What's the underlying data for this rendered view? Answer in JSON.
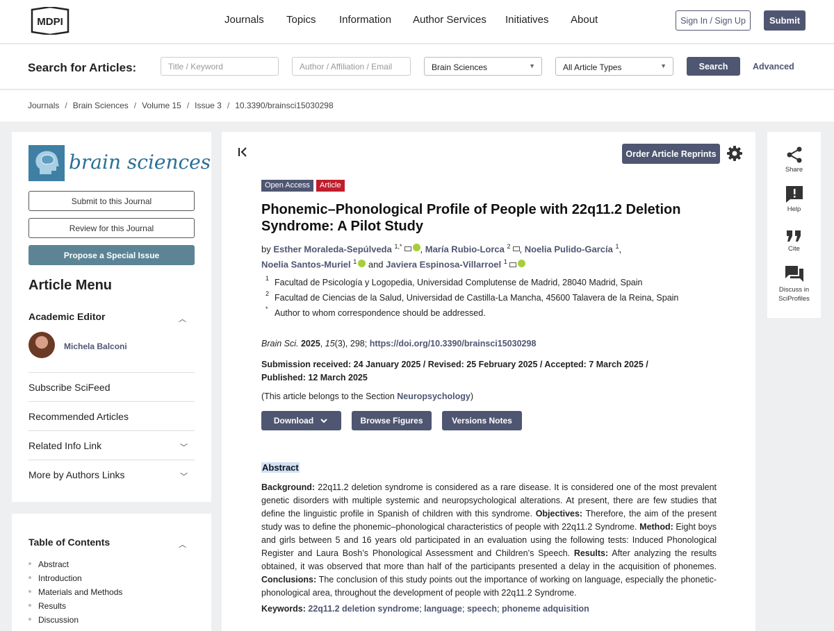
{
  "header": {
    "logo_text": "MDPI",
    "nav": [
      "Journals",
      "Topics",
      "Information",
      "Author Services",
      "Initiatives",
      "About"
    ],
    "sign_in_label": "Sign In / Sign Up",
    "submit_label": "Submit"
  },
  "search": {
    "title": "Search for Articles:",
    "keyword_placeholder": "Title / Keyword",
    "author_placeholder": "Author / Affiliation / Email",
    "journal_selected": "Brain Sciences",
    "type_selected": "All Article Types",
    "search_label": "Search",
    "advanced_label": "Advanced"
  },
  "breadcrumb": [
    "Journals",
    "Brain Sciences",
    "Volume 15",
    "Issue 3",
    "10.3390/brainsci15030298"
  ],
  "sidebar": {
    "journal_name": "brain sciences",
    "submit_label": "Submit to this Journal",
    "review_label": "Review for this Journal",
    "propose_label": "Propose a Special Issue",
    "menu_title": "Article Menu",
    "academic_editor_label": "Academic Editor",
    "editor_name": "Michela Balconi",
    "menu_items": [
      "Subscribe SciFeed",
      "Recommended Articles",
      "Related Info Link",
      "More by Authors Links"
    ],
    "toc_title": "Table of Contents",
    "toc_items": [
      "Abstract",
      "Introduction",
      "Materials and Methods",
      "Results",
      "Discussion"
    ]
  },
  "article": {
    "reprints_label": "Order Article Reprints",
    "badge_open_access": "Open Access",
    "badge_type": "Article",
    "title": "Phonemic–Phonological Profile of People with 22q11.2 Deletion Syndrome: A Pilot Study",
    "by": "by",
    "and": "and",
    "authors": [
      {
        "name": "Esther Moraleda-Sepúlveda",
        "sup": "1,*"
      },
      {
        "name": "María Rubio-Lorca",
        "sup": "2"
      },
      {
        "name": "Noelia Pulido-García",
        "sup": "1"
      },
      {
        "name": "Noelia Santos-Muriel",
        "sup": "1"
      },
      {
        "name": "Javiera Espinosa-Villarroel",
        "sup": "1"
      }
    ],
    "affiliations": [
      {
        "mark": "1",
        "text": "Facultad de Psicología y Logopedia, Universidad Complutense de Madrid, 28040 Madrid, Spain"
      },
      {
        "mark": "2",
        "text": "Facultad de Ciencias de la Salud, Universidad de Castilla-La Mancha, 45600 Talavera de la Reina, Spain"
      },
      {
        "mark": "*",
        "text": "Author to whom correspondence should be addressed."
      }
    ],
    "citation": {
      "journal": "Brain Sci.",
      "year": "2025",
      "volume": "15",
      "issue_pages": "(3), 298;",
      "doi": "https://doi.org/10.3390/brainsci15030298"
    },
    "dates": "Submission received: 24 January 2025 / Revised: 25 February 2025 / Accepted: 7 March 2025 / Published: 12 March 2025",
    "section_prefix": "(This article belongs to the Section ",
    "section_name": "Neuropsychology",
    "section_suffix": ")",
    "download_label": "Download",
    "figures_label": "Browse Figures",
    "versions_label": "Versions Notes",
    "abstract_heading": "Abstract",
    "abstract": {
      "background_label": "Background:",
      "background": " 22q11.2 deletion syndrome is considered as a rare disease. It is considered one of the most prevalent genetic disorders with multiple systemic and neuropsychological alterations. At present, there are few studies that define the linguistic profile in Spanish of children with this syndrome. ",
      "objectives_label": "Objectives:",
      "objectives": " Therefore, the aim of the present study was to define the phonemic–phonological characteristics of people with 22q11.2 Syndrome. ",
      "method_label": "Method:",
      "method": " Eight boys and girls between 5 and 16 years old participated in an evaluation using the following tests: Induced Phonological Register and Laura Bosh’s Phonological Assessment and Children’s Speech. ",
      "results_label": "Results:",
      "results": " After analyzing the results obtained, it was observed that more than half of the participants presented a delay in the acquisition of phonemes. ",
      "conclusions_label": "Conclusions:",
      "conclusions": " The conclusion of this study points out the importance of working on language, especially the phonetic-phonological area, throughout the development of people with 22q11.2 Syndrome."
    },
    "keywords_label": "Keywords:",
    "keywords": [
      "22q11.2 deletion syndrome",
      "language",
      "speech",
      "phoneme adquisition"
    ]
  },
  "tools": [
    "Share",
    "Help",
    "Cite",
    "Discuss in SciProfiles"
  ],
  "colors": {
    "primary": "#4f5671",
    "badge_red": "#c01d2c",
    "journal_blue": "#2a6f97",
    "orcid": "#a6ce39"
  },
  "icons": [
    "collapse-icon",
    "gear-icon",
    "share-icon",
    "help-icon",
    "cite-icon",
    "discuss-icon",
    "mail-icon",
    "orcid-icon",
    "chevron-up-icon",
    "chevron-down-icon",
    "caret-down-icon"
  ]
}
